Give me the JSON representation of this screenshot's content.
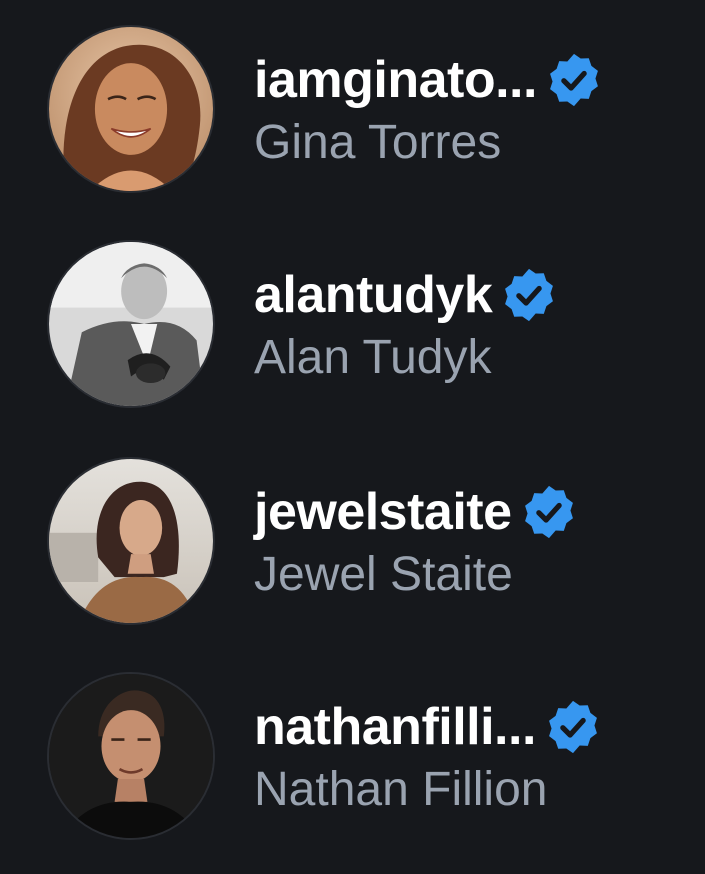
{
  "accounts": [
    {
      "handle": "iamginato...",
      "name": "Gina Torres",
      "verified": true,
      "avatar": "gina-torres-photo"
    },
    {
      "handle": "alantudyk",
      "name": "Alan Tudyk",
      "verified": true,
      "avatar": "alan-tudyk-photo"
    },
    {
      "handle": "jewelstaite",
      "name": "Jewel Staite",
      "verified": true,
      "avatar": "jewel-staite-photo"
    },
    {
      "handle": "nathanfilli...",
      "name": "Nathan Fillion",
      "verified": true,
      "avatar": "nathan-fillion-photo"
    }
  ],
  "colors": {
    "background": "#16181c",
    "handle": "#ffffff",
    "name": "#9aa3b0",
    "verified_badge": "#3797f0"
  },
  "icons": {
    "verified": "verified-check-icon"
  }
}
